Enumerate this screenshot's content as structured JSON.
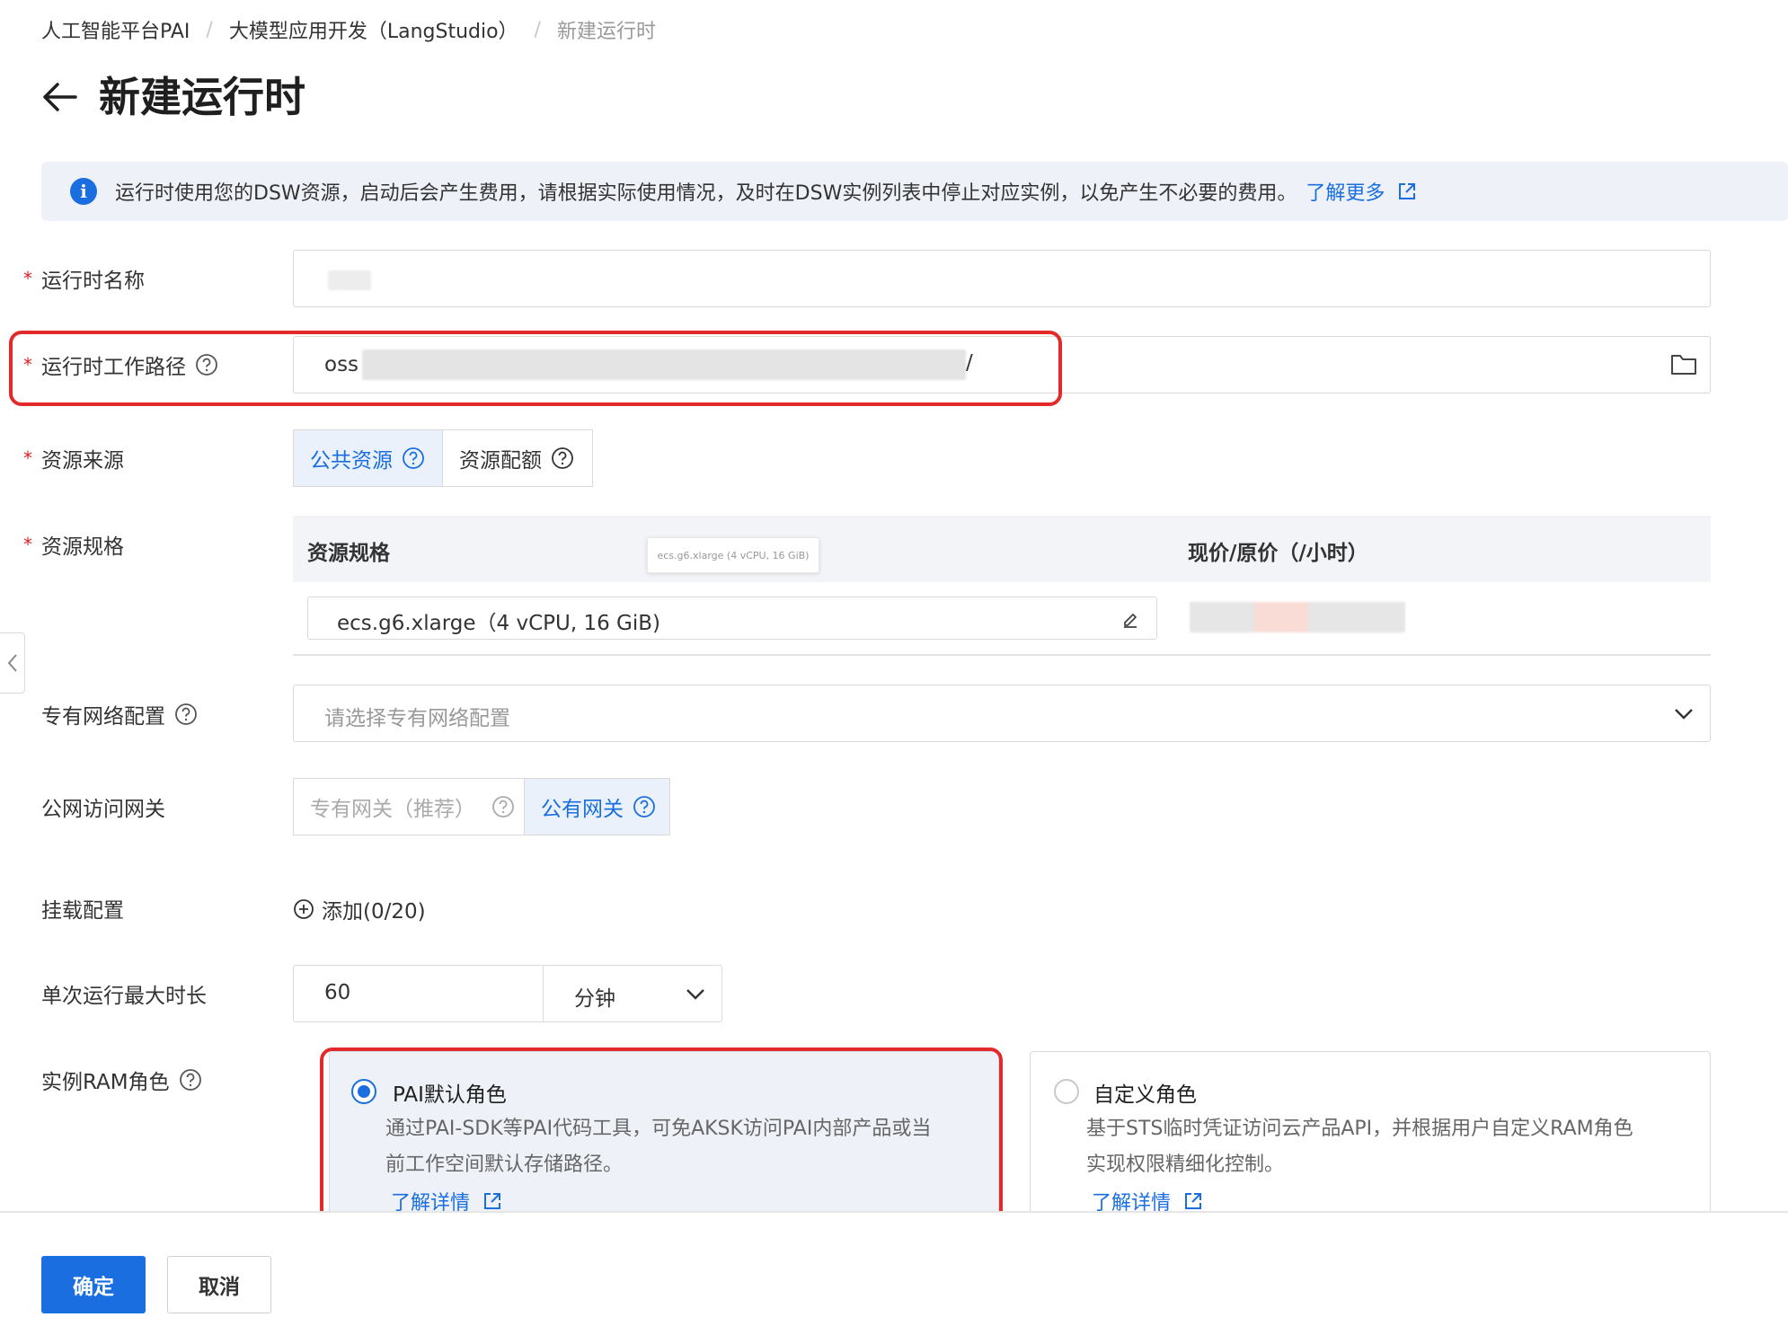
{
  "breadcrumb": [
    "人工智能平台PAI",
    "大模型应用开发（LangStudio）",
    "新建运行时"
  ],
  "page_title": "新建运行时",
  "alert": {
    "text": "运行时使用您的DSW资源，启动后会产生费用，请根据实际使用情况，及时在DSW实例列表中停止对应实例，以免产生不必要的费用。",
    "link": "了解更多"
  },
  "form": {
    "runtime_name": {
      "label": "运行时名称",
      "value": ""
    },
    "work_path": {
      "label": "运行时工作路径",
      "value_prefix": "oss",
      "value_suffix": "/"
    },
    "resource_source": {
      "label": "资源来源",
      "options": [
        "公共资源",
        "资源配额"
      ],
      "selected": "公共资源"
    },
    "resource_spec": {
      "label": "资源规格",
      "columns": [
        "资源规格",
        "现价/原价（/小时）"
      ],
      "tooltip": "ecs.g6.xlarge (4 vCPU, 16 GiB)",
      "value": "ecs.g6.xlarge（4 vCPU, 16 GiB)"
    },
    "vpc": {
      "label": "专有网络配置",
      "placeholder": "请选择专有网络配置"
    },
    "gateway": {
      "label": "公网访问网关",
      "options": [
        "专有网关（推荐）",
        "公有网关"
      ],
      "selected": "公有网关"
    },
    "mount": {
      "label": "挂载配置",
      "add_label": "添加(0/20)"
    },
    "max_duration": {
      "label": "单次运行最大时长",
      "value": "60",
      "unit": "分钟"
    },
    "ram_role": {
      "label": "实例RAM角色",
      "cards": [
        {
          "title": "PAI默认角色",
          "desc_line1": "通过PAI-SDK等PAI代码工具，可免AKSK访问PAI内部产品或当",
          "desc_line2": "前工作空间默认存储路径。",
          "link": "了解详情",
          "selected": true
        },
        {
          "title": "自定义角色",
          "desc_line1": "基于STS临时凭证访问云产品API，并根据用户自定义RAM角色",
          "desc_line2": "实现权限精细化控制。",
          "link": "了解详情",
          "selected": false
        }
      ]
    }
  },
  "buttons": {
    "confirm": "确定",
    "cancel": "取消"
  },
  "colors": {
    "primary": "#1a6ee0",
    "highlight": "#e22a2a",
    "required": "#e02020"
  }
}
